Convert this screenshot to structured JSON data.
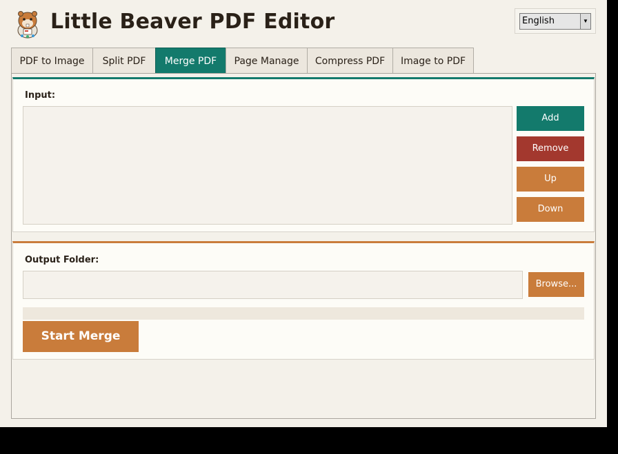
{
  "app": {
    "title": "Little Beaver PDF Editor",
    "logo_icon": "beaver-logo-icon"
  },
  "language": {
    "selected": "English",
    "dropdown_icon": "dropdown-arrow-icon"
  },
  "tabs": [
    {
      "label": "PDF to Image",
      "active": false
    },
    {
      "label": "Split PDF",
      "active": false
    },
    {
      "label": "Merge PDF",
      "active": true
    },
    {
      "label": "Page Manage",
      "active": false
    },
    {
      "label": "Compress PDF",
      "active": false
    },
    {
      "label": "Image to PDF",
      "active": false
    }
  ],
  "input_section": {
    "label": "Input:",
    "files": [],
    "buttons": {
      "add": "Add",
      "remove": "Remove",
      "up": "Up",
      "down": "Down"
    }
  },
  "output_section": {
    "label": "Output Folder:",
    "value": "",
    "browse": "Browse..."
  },
  "progress": {
    "fraction": 0
  },
  "start_button": "Start Merge",
  "colors": {
    "primary_teal": "#137a6c",
    "accent_orange": "#c97c3b",
    "danger_red": "#a3382e",
    "background": "#f4f1ea"
  }
}
